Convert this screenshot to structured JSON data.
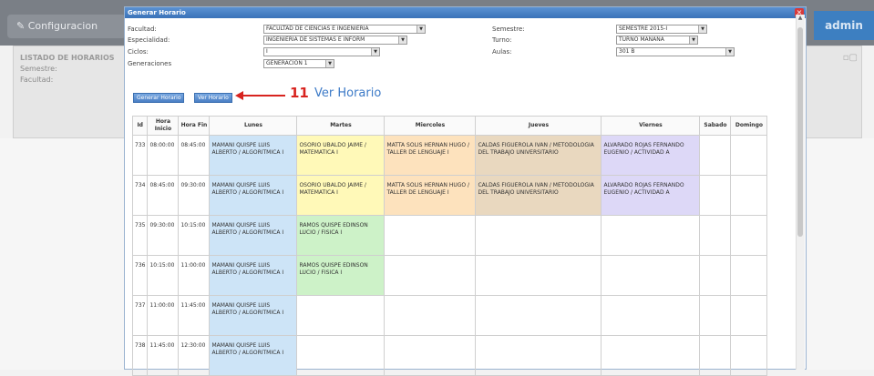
{
  "background": {
    "config_label": "Configuracion",
    "admin_label": "admin",
    "listado_title": "LISTADO DE HORARIOS",
    "semestre_label": "Semestre:",
    "facultad_label": "Facultad:"
  },
  "modal": {
    "title": "Generar Horario",
    "close": "×"
  },
  "form": {
    "facultad": {
      "label": "Facultad:",
      "value": "FACULTAD DE CIENCIAS E INGENIERÍA"
    },
    "especialidad": {
      "label": "Especialidad:",
      "value": "INGENIERÍA DE SISTEMAS E INFORM"
    },
    "ciclos": {
      "label": "Ciclos:",
      "value": "I"
    },
    "generaciones": {
      "label": "Generaciones",
      "value": "GENERACION 1"
    },
    "semestre": {
      "label": "Semestre:",
      "value": "SEMESTRE 2015-I"
    },
    "turno": {
      "label": "Turno:",
      "value": "TURNO MAÑANA"
    },
    "aulas": {
      "label": "Aulas:",
      "value": "301 B"
    }
  },
  "buttons": {
    "generar": "Generar Horario",
    "ver": "Ver Horario"
  },
  "annotation": {
    "number": "11",
    "text": "Ver Horario"
  },
  "table": {
    "headers": [
      "Id",
      "Hora Inicio",
      "Hora Fin",
      "Lunes",
      "Martes",
      "Miercoles",
      "Jueves",
      "Viernes",
      "Sabado",
      "Domingo"
    ],
    "rows": [
      {
        "id": "733",
        "inicio": "08:00:00",
        "fin": "08:45:00",
        "lunes": "MAMANI QUISPE LUIS ALBERTO / ALGORITMICA I",
        "martes": "OSORIO UBALDO JAIME / MATEMATICA I",
        "miercoles": "MATTA SOLIS HERNAN HUGO / TALLER DE LENGUAJE I",
        "jueves": "CALDAS FIGUEROLA IVAN / METODOLOGIA DEL TRABAJO UNIVERSITARIO",
        "viernes": "ALVARADO ROJAS FERNANDO EUGENIO / ACTIVIDAD A"
      },
      {
        "id": "734",
        "inicio": "08:45:00",
        "fin": "09:30:00",
        "lunes": "MAMANI QUISPE LUIS ALBERTO / ALGORITMICA I",
        "martes": "OSORIO UBALDO JAIME / MATEMATICA I",
        "miercoles": "MATTA SOLIS HERNAN HUGO / TALLER DE LENGUAJE I",
        "jueves": "CALDAS FIGUEROLA IVAN / METODOLOGIA DEL TRABAJO UNIVERSITARIO",
        "viernes": "ALVARADO ROJAS FERNANDO EUGENIO / ACTIVIDAD A"
      },
      {
        "id": "735",
        "inicio": "09:30:00",
        "fin": "10:15:00",
        "lunes": "MAMANI QUISPE LUIS ALBERTO / ALGORITMICA I",
        "martes": "RAMOS QUISPE EDINSON LUCIO / FISICA I",
        "miercoles": "",
        "jueves": "",
        "viernes": ""
      },
      {
        "id": "736",
        "inicio": "10:15:00",
        "fin": "11:00:00",
        "lunes": "MAMANI QUISPE LUIS ALBERTO / ALGORITMICA I",
        "martes": "RAMOS QUISPE EDINSON LUCIO / FISICA I",
        "miercoles": "",
        "jueves": "",
        "viernes": ""
      },
      {
        "id": "737",
        "inicio": "11:00:00",
        "fin": "11:45:00",
        "lunes": "MAMANI QUISPE LUIS ALBERTO / ALGORITMICA I",
        "martes": "",
        "miercoles": "",
        "jueves": "",
        "viernes": ""
      },
      {
        "id": "738",
        "inicio": "11:45:00",
        "fin": "12:30:00",
        "lunes": "MAMANI QUISPE LUIS ALBERTO / ALGORITMICA I",
        "martes": "",
        "miercoles": "",
        "jueves": "",
        "viernes": ""
      }
    ]
  },
  "colors": {
    "lunes": "#cde4f7",
    "martes_math": "#fff9b8",
    "martes_fisica": "#cdf2c8",
    "miercoles": "#fde2bd",
    "jueves": "#e9d8bf",
    "viernes": "#ddd8f7",
    "accent": "#d8241f"
  }
}
